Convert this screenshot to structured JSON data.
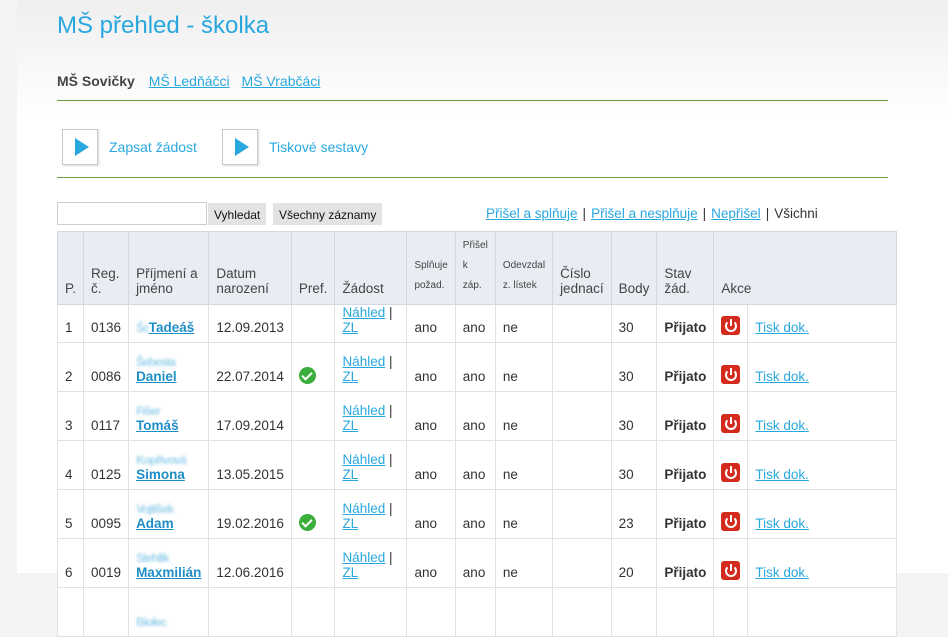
{
  "page": {
    "title": "MŠ přehled - školka",
    "school_tabs": {
      "active": "MŠ Sovičky",
      "links": [
        "MŠ Ledňáčci",
        "MŠ Vrabčáci"
      ]
    },
    "actions": {
      "zapsat": "Zapsat žádost",
      "tisk": "Tiskové sestavy"
    },
    "search": {
      "value": "",
      "search_btn": "Vyhledat",
      "all_btn": "Všechny záznamy"
    },
    "filters": {
      "prisel_splnuje": "Přišel a splňuje",
      "prisel_nesplnuje": "Přišel a nesplňuje",
      "neprisel": "Nepřišel",
      "vsichni": "Všichni",
      "sep": "|"
    },
    "table": {
      "headers": {
        "p": "P.",
        "reg1": "Reg.",
        "reg2": "č.",
        "name1": "Příjmení a",
        "name2": "jméno",
        "datum1": "Datum",
        "datum2": "narození",
        "pref": "Pref.",
        "zadost": "Žádost",
        "splnuje1": "Splňuje",
        "splnuje2": "požad.",
        "prisel1": "Přišel",
        "prisel2": "k záp.",
        "odevzdal1": "Odevzdal",
        "odevzdal2": "z. lístek",
        "cislo1": "Číslo",
        "cislo2": "jednací",
        "body": "Body",
        "stav1": "Stav",
        "stav2": "žád.",
        "akce": "Akce"
      },
      "link_nahled": "Náhled",
      "link_zl": "ZL",
      "link_sep": "|",
      "link_tisk": "Tisk dok.",
      "rows": [
        {
          "p": "1",
          "reg": "0136",
          "surname": "",
          "name": "Tadeáš",
          "date": "12.09.2013",
          "pref": false,
          "splnuje": "ano",
          "prisel": "ano",
          "odevzdal": "ne",
          "cislo": "",
          "body": "30",
          "stav": "Přijato"
        },
        {
          "p": "2",
          "reg": "0086",
          "surname": "",
          "name": "Daniel",
          "date": "22.07.2014",
          "pref": true,
          "splnuje": "ano",
          "prisel": "ano",
          "odevzdal": "ne",
          "cislo": "",
          "body": "30",
          "stav": "Přijato"
        },
        {
          "p": "3",
          "reg": "0117",
          "surname": "",
          "name": "Tomáš",
          "date": "17.09.2014",
          "pref": false,
          "splnuje": "ano",
          "prisel": "ano",
          "odevzdal": "ne",
          "cislo": "",
          "body": "30",
          "stav": "Přijato"
        },
        {
          "p": "4",
          "reg": "0125",
          "surname": "",
          "name": "Simona",
          "date": "13.05.2015",
          "pref": false,
          "splnuje": "ano",
          "prisel": "ano",
          "odevzdal": "ne",
          "cislo": "",
          "body": "30",
          "stav": "Přijato"
        },
        {
          "p": "5",
          "reg": "0095",
          "surname": "",
          "name": "Adam",
          "date": "19.02.2016",
          "pref": true,
          "splnuje": "ano",
          "prisel": "ano",
          "odevzdal": "ne",
          "cislo": "",
          "body": "23",
          "stav": "Přijato"
        },
        {
          "p": "6",
          "reg": "0019",
          "surname": "",
          "name": "Maxmilián",
          "date": "12.06.2016",
          "pref": false,
          "splnuje": "ano",
          "prisel": "ano",
          "odevzdal": "ne",
          "cislo": "",
          "body": "20",
          "stav": "Přijato"
        }
      ]
    }
  }
}
